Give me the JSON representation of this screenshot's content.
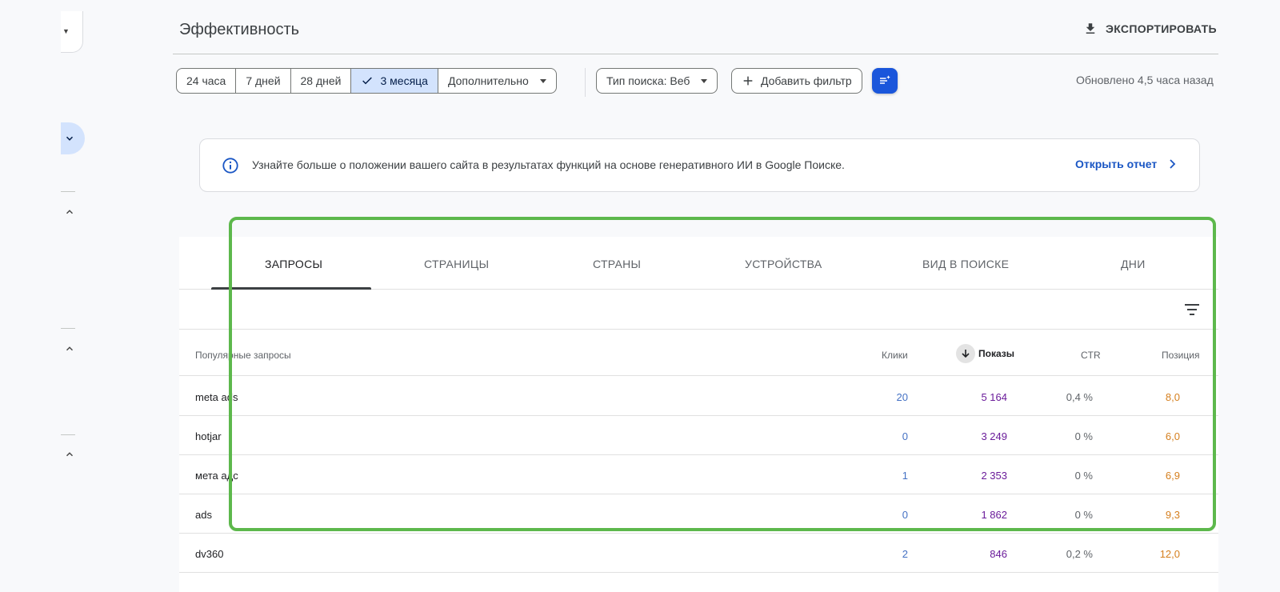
{
  "header": {
    "title": "Эффективность",
    "export_label": "ЭКСПОРТИРОВАТЬ"
  },
  "date_range": {
    "options": [
      "24 часа",
      "7 дней",
      "28 дней",
      "3 месяца",
      "Дополнительно"
    ],
    "selected": "3 месяца"
  },
  "filters": {
    "search_type": "Тип поиска: Веб",
    "add_filter": "Добавить фильтр",
    "updated": "Обновлено 4,5 часа назад"
  },
  "banner": {
    "message": "Узнайте больше о положении вашего сайта в результатах функций на основе генеративного ИИ в Google Поиске.",
    "link": "Открыть отчет"
  },
  "tabs": [
    "ЗАПРОСЫ",
    "СТРАНИЦЫ",
    "СТРАНЫ",
    "УСТРОЙСТВА",
    "ВИД В ПОИСКЕ",
    "ДНИ"
  ],
  "active_tab": "ЗАПРОСЫ",
  "table": {
    "columns": {
      "query": "Популярные запросы",
      "clicks": "Клики",
      "impressions": "Показы",
      "ctr": "CTR",
      "position": "Позиция"
    },
    "sorted_by": "Показы",
    "rows": [
      {
        "query": "meta ads",
        "clicks": "20",
        "impressions": "5 164",
        "ctr": "0,4 %",
        "position": "8,0"
      },
      {
        "query": "hotjar",
        "clicks": "0",
        "impressions": "3 249",
        "ctr": "0 %",
        "position": "6,0"
      },
      {
        "query": "мета адс",
        "clicks": "1",
        "impressions": "2 353",
        "ctr": "0 %",
        "position": "6,9"
      },
      {
        "query": "ads",
        "clicks": "0",
        "impressions": "1 862",
        "ctr": "0 %",
        "position": "9,3"
      },
      {
        "query": "dv360",
        "clicks": "2",
        "impressions": "846",
        "ctr": "0,2 %",
        "position": "12,0"
      }
    ]
  },
  "colors": {
    "accent": "#1a56db",
    "selected_segment": "#d3e3fd",
    "clicks": "#4471c4",
    "impressions": "#6a1b9a",
    "position": "#d57f1e",
    "highlight": "#5db84c"
  },
  "icons": [
    "download-icon",
    "check-icon",
    "plus-icon",
    "filter-settings-icon",
    "info-icon",
    "chevron-right-icon",
    "filter-list-icon",
    "arrow-down-icon",
    "chevron-down-icon",
    "chevron-up-icon"
  ]
}
